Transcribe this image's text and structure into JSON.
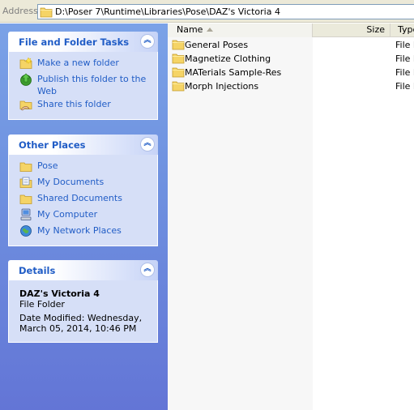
{
  "address": {
    "label": "Address",
    "path": "D:\\Poser 7\\Runtime\\Libraries\\Pose\\DAZ's Victoria 4"
  },
  "tasks_panel": {
    "title": "File and Folder Tasks",
    "items": [
      {
        "label": "Make a new folder",
        "icon": "new-folder-icon"
      },
      {
        "label": "Publish this folder to the Web",
        "icon": "publish-web-icon"
      },
      {
        "label": "Share this folder",
        "icon": "share-folder-icon"
      }
    ]
  },
  "places_panel": {
    "title": "Other Places",
    "items": [
      {
        "label": "Pose",
        "icon": "folder-icon"
      },
      {
        "label": "My Documents",
        "icon": "my-documents-icon"
      },
      {
        "label": "Shared Documents",
        "icon": "folder-icon"
      },
      {
        "label": "My Computer",
        "icon": "my-computer-icon"
      },
      {
        "label": "My Network Places",
        "icon": "network-places-icon"
      }
    ]
  },
  "details_panel": {
    "title": "Details",
    "name": "DAZ's Victoria 4",
    "kind": "File Folder",
    "modified": "Date Modified: Wednesday, March 05, 2014, 10:46 PM"
  },
  "list": {
    "columns": {
      "name": "Name",
      "size": "Size",
      "type": "Type"
    },
    "rows": [
      {
        "name": "General Poses",
        "type": "File F"
      },
      {
        "name": "Magnetize Clothing",
        "type": "File F"
      },
      {
        "name": "MATerials Sample-Res",
        "type": "File F"
      },
      {
        "name": "Morph Injections",
        "type": "File F"
      }
    ]
  },
  "colors": {
    "task_link": "#215dc6",
    "pane_gradient_top": "#7ba2e7",
    "pane_gradient_bottom": "#6375d6",
    "panel_body": "#d6dff7",
    "folder_yellow": "#f5d466"
  }
}
